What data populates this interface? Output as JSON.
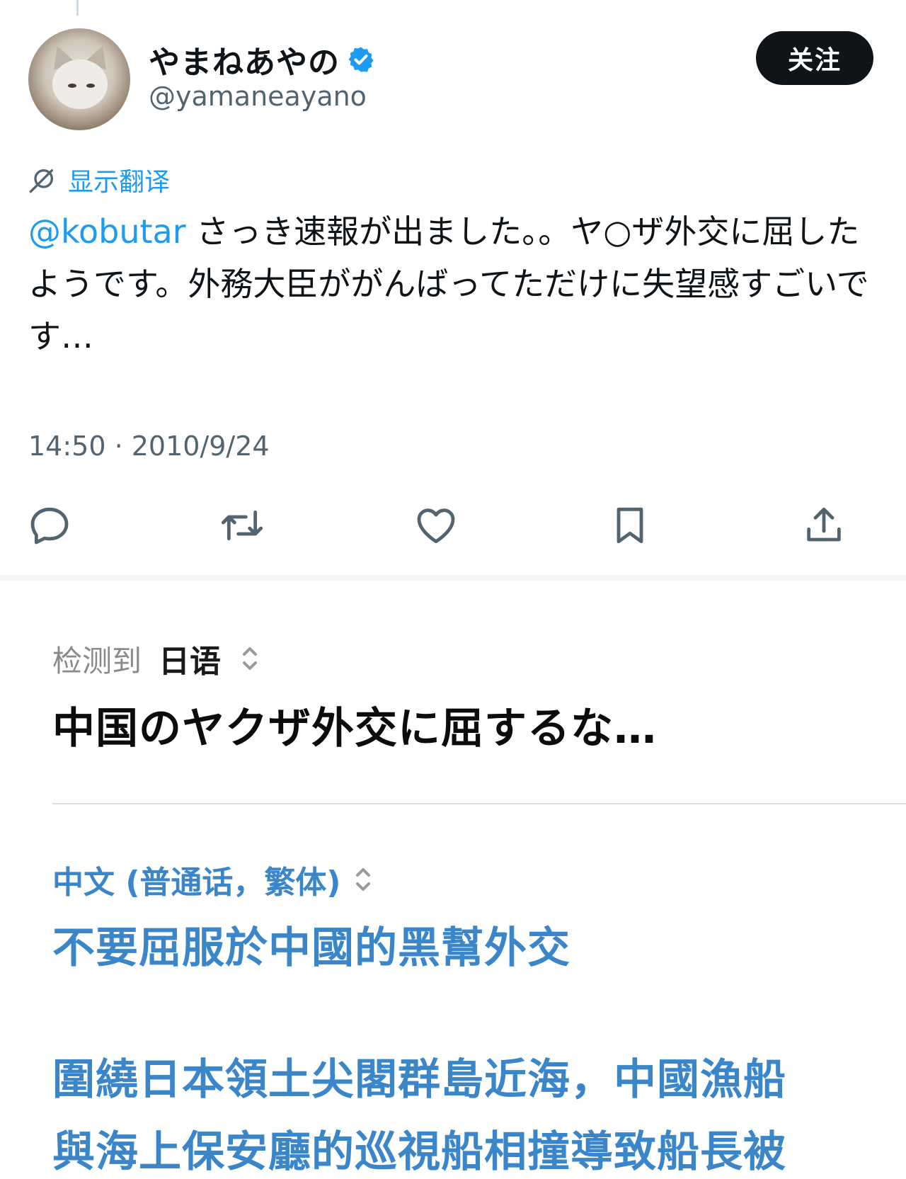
{
  "tweet": {
    "display_name": "やまねあやの",
    "handle": "@yamaneayano",
    "follow_label": "关注",
    "translate_link": "显示翻译",
    "mention": "@kobutar",
    "body": " さっき速報が出ました。。ヤ○ザ外交に屈したようです。外務大臣ががんばってただけに失望感すごいです…",
    "timestamp": "14:50 · 2010/9/24",
    "icons": {
      "verified": "verified-badge-icon",
      "translate": "translate-icon",
      "reply": "reply-icon",
      "retweet": "retweet-icon",
      "like": "heart-icon",
      "bookmark": "bookmark-icon",
      "share": "share-icon"
    },
    "colors": {
      "accent": "#1d9bf0",
      "text": "#0f1419",
      "muted": "#536471"
    }
  },
  "translation": {
    "detected_label": "检测到",
    "detected_language": "日语",
    "source_text": "中国のヤクザ外交に屈するな…",
    "target_language": "中文 (普通话，繁体)",
    "target_lines": [
      "不要屈服於中國的黑幫外交",
      "圍繞日本領土尖閣群島近海，中國漁船",
      "與海上保安廳的巡視船相撞導致船長被"
    ],
    "colors": {
      "target": "#3a86c8"
    }
  }
}
